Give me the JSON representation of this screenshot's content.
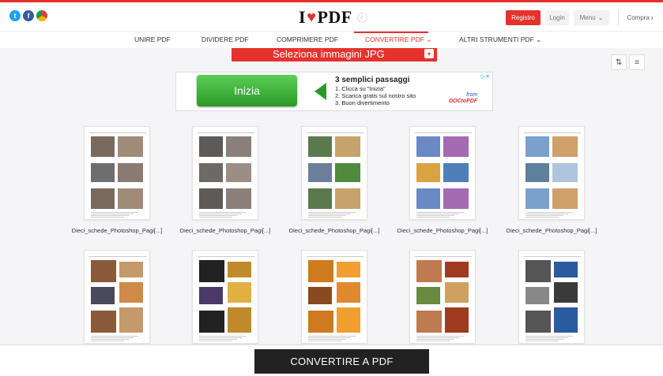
{
  "header": {
    "logo_left": "I",
    "logo_right": "PDF",
    "register": "Registro",
    "login": "Login",
    "menu": "Menu",
    "buy": "Compra",
    "social": [
      "twitter-icon",
      "facebook-icon",
      "chrome-icon"
    ]
  },
  "nav": {
    "items": [
      {
        "label": "UNIRE PDF"
      },
      {
        "label": "DIVIDERE PDF"
      },
      {
        "label": "COMPRIMERE PDF"
      },
      {
        "label": "CONVERTIRE PDF"
      },
      {
        "label": "ALTRI STRUMENTI PDF"
      }
    ],
    "active_index": 3
  },
  "main": {
    "select_button": "Seleziona immagini JPG"
  },
  "ad": {
    "button": "Inizia",
    "heading": "3 semplici passaggi",
    "steps": [
      "1. Clicca su \"Inizia\"",
      "2. Scarica gratis sul nostro sito",
      "3. Buon divertimento"
    ],
    "brand_from": "from",
    "brand_name": "DOCtoPDF"
  },
  "files": [
    {
      "label": "Dieci_schede_Photoshop_Pagi[...]"
    },
    {
      "label": "Dieci_schede_Photoshop_Pagi[...]"
    },
    {
      "label": "Dieci_schede_Photoshop_Pagi[...]"
    },
    {
      "label": "Dieci_schede_Photoshop_Pagi[...]"
    },
    {
      "label": "Dieci_schede_Photoshop_Pagi[...]"
    }
  ],
  "footer": {
    "convert_button": "CONVERTIRE A PDF"
  },
  "colors": {
    "accent": "#e5322d",
    "dark": "#222222",
    "ad_green": "#2a9a27"
  }
}
